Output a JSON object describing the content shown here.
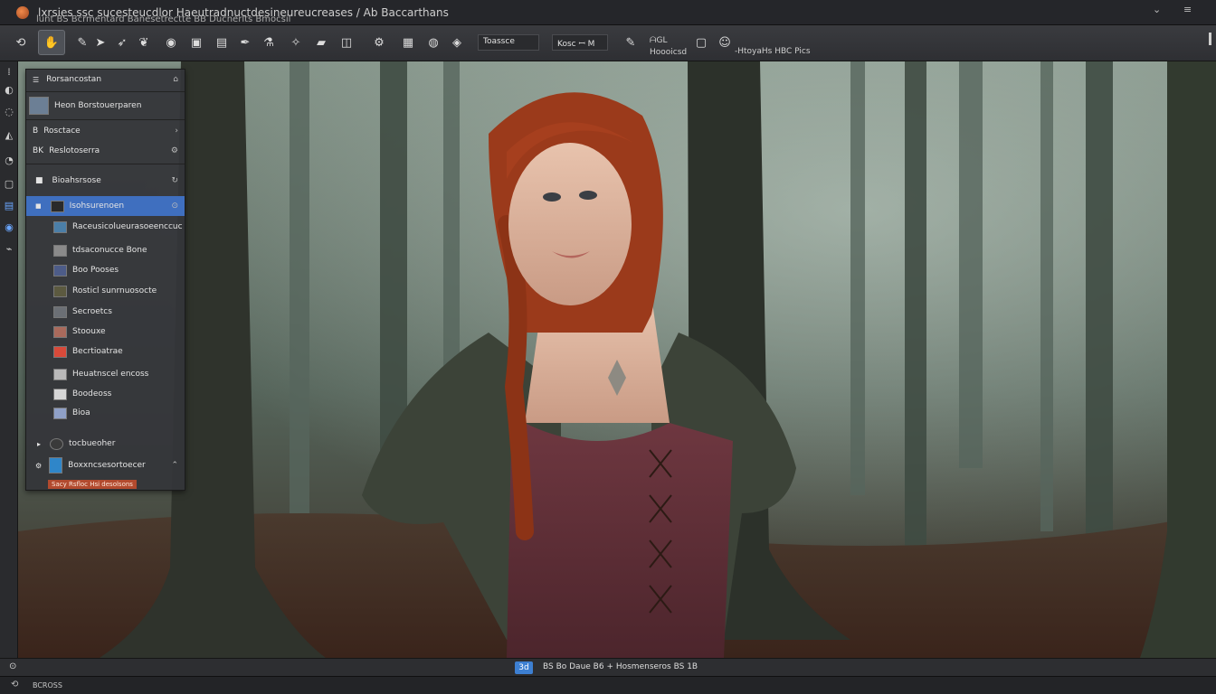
{
  "window": {
    "title": "lxrsies ssc sucesteucdlor Haeutradnuctdesineureucreases / Ab Baccarthans",
    "subtitle": "lunt    BS Bcrmentard    Banesetrectte    BB Ducnerlts    Bmocsil",
    "controls": [
      "⌄",
      "≡"
    ]
  },
  "toolbar": {
    "icons": [
      "rotate-icon",
      "hand-icon",
      "brush-icon",
      "arrow-icon",
      "feather-icon",
      "bird-icon",
      "globe-icon",
      "box-icon",
      "monitor-icon",
      "quill-icon",
      "flask-icon",
      "fish-icon",
      "folder-icon",
      "camera-icon",
      "settings-icon",
      "paint-icon",
      "palette-icon",
      "chrome-icon"
    ],
    "field_1": "Toassce",
    "field_2": "Kosc  ꟷ M",
    "right_label_1": "ᗩGL",
    "right_label_2": "Hoooicsd",
    "right_label_3": "-HtoyaHs  HBC  Pics"
  },
  "panel": {
    "header": "Rorsancostan",
    "rows": [
      {
        "label": "Heon Borstouerparen",
        "thumb": "#6c7f95"
      },
      {
        "label": "Rosctace",
        "prefix": "B"
      },
      {
        "label": "Reslotoserra",
        "prefix": "BK"
      },
      {
        "label": "Bioahsrsose",
        "prefix": "■"
      },
      {
        "label": "Isohsurenoen",
        "prefix": "■",
        "selected": true
      },
      {
        "label": "Raceusicolueurasoeenccuc",
        "thumb": "#4b7fa8"
      },
      {
        "label": "tdsaconucce Bone",
        "thumb": "#8a8a8a"
      },
      {
        "label": "Boo Pooses",
        "thumb": "#4d5c88"
      },
      {
        "label": "Rosticl sunrnuosocte",
        "thumb": "#5c5a40"
      },
      {
        "label": "Secroetcs",
        "thumb": "#6b6f75"
      },
      {
        "label": "Stoouxe",
        "thumb": "#a96a5c"
      },
      {
        "label": "Becrtioatrae",
        "thumb": "#d84a3a"
      },
      {
        "label": "Heuatnscel encoss",
        "thumb": "#b9b9b9"
      },
      {
        "label": "Boodeoss",
        "thumb": "#d6d6d6"
      },
      {
        "label": "Bioa",
        "thumb": "#8fa0c7"
      },
      {
        "label": "tocbueoher",
        "thumb": "#3a3a3a"
      },
      {
        "label": "Boxxncsesortoecer",
        "thumb": "#2f86c9"
      }
    ],
    "footer_badge": "Sacy Rsfloc Hsi desolsons"
  },
  "statusbar": {
    "zoom": "3d",
    "info": "BS    Bo Daue    B6   +  Hosmenseros   BS 1B"
  },
  "bottombar": {
    "text": "BCROSS"
  },
  "colors": {
    "accent": "#3f6fbf",
    "toolbar": "#343539",
    "panel": "#343539",
    "badge": "#b24a2e"
  }
}
